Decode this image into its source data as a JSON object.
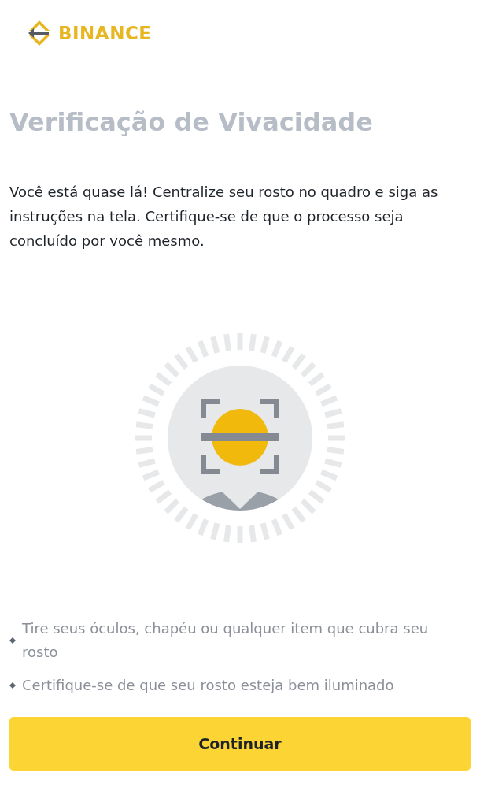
{
  "logo": {
    "text": "BINANCE"
  },
  "title": "Verificação de Vivacidade",
  "description": "Você está quase lá! Centralize seu rosto no quadro e siga as instruções na tela. Certifique-se de que o processo seja concluído por você mesmo.",
  "tips": [
    "Tire seus óculos, chapéu ou qualquer item que cubra seu rosto",
    "Certifique-se de que seu rosto esteja bem iluminado"
  ],
  "buttons": [
    {
      "label": "Continuar"
    }
  ]
}
